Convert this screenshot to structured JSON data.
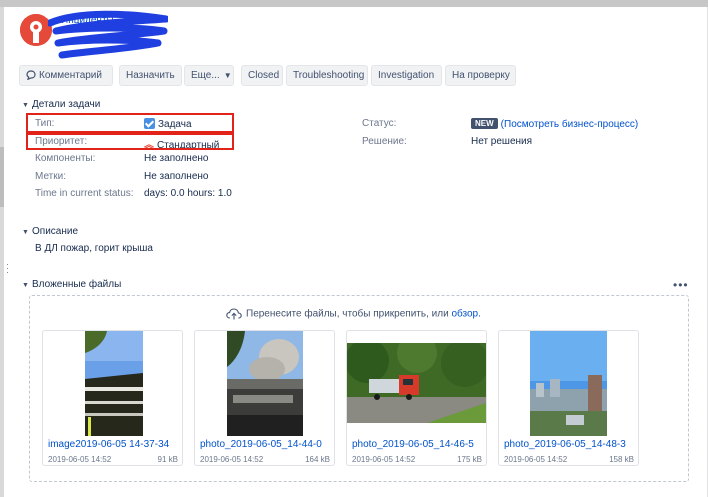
{
  "breadcrumb": "Инциденты",
  "toolbar": {
    "comment": "Комментарий",
    "assign": "Назначить",
    "more": "Еще...",
    "closed": "Closed",
    "troubleshooting": "Troubleshooting",
    "investigation": "Investigation",
    "review": "На проверку"
  },
  "details": {
    "title": "Детали задачи",
    "type_label": "Тип:",
    "type_value": "Задача",
    "priority_label": "Приоритет:",
    "priority_value": "Стандартный",
    "components_label": "Компоненты:",
    "components_value": "Не заполнено",
    "labels_label": "Метки:",
    "labels_value": "Не заполнено",
    "time_label": "Time in current status:",
    "time_value": "days: 0.0 hours: 1.0",
    "status_label": "Статус:",
    "status_badge": "NEW",
    "status_link": "(Посмотреть бизнес-процесс)",
    "resolution_label": "Решение:",
    "resolution_value": "Нет решения"
  },
  "description": {
    "title": "Описание",
    "text": "В ДЛ пожар, горит крыша"
  },
  "attachments": {
    "title": "Вложенные файлы",
    "drop_text": "Перенесите файлы, чтобы прикрепить, или",
    "drop_link": "обзор.",
    "files": [
      {
        "name": "image2019-06-05 14-37-34",
        "date": "2019-06-05 14:52",
        "size": "91 kB"
      },
      {
        "name": "photo_2019-06-05_14-44-0",
        "date": "2019-06-05 14:52",
        "size": "164 kB"
      },
      {
        "name": "photo_2019-06-05_14-46-5",
        "date": "2019-06-05 14:52",
        "size": "175 kB"
      },
      {
        "name": "photo_2019-06-05_14-48-3",
        "date": "2019-06-05 14:52",
        "size": "158 kB"
      }
    ]
  },
  "colors": {
    "accent": "#0052cc",
    "logo": "#e5493a",
    "highlight": "#e2231a",
    "redaction": "#1f3fe0"
  },
  "icons": [
    "jira-logo-icon",
    "comment-icon",
    "chevron-down-icon",
    "checkbox-icon",
    "priority-chevrons-icon",
    "cloud-upload-icon",
    "more-dots-icon"
  ]
}
